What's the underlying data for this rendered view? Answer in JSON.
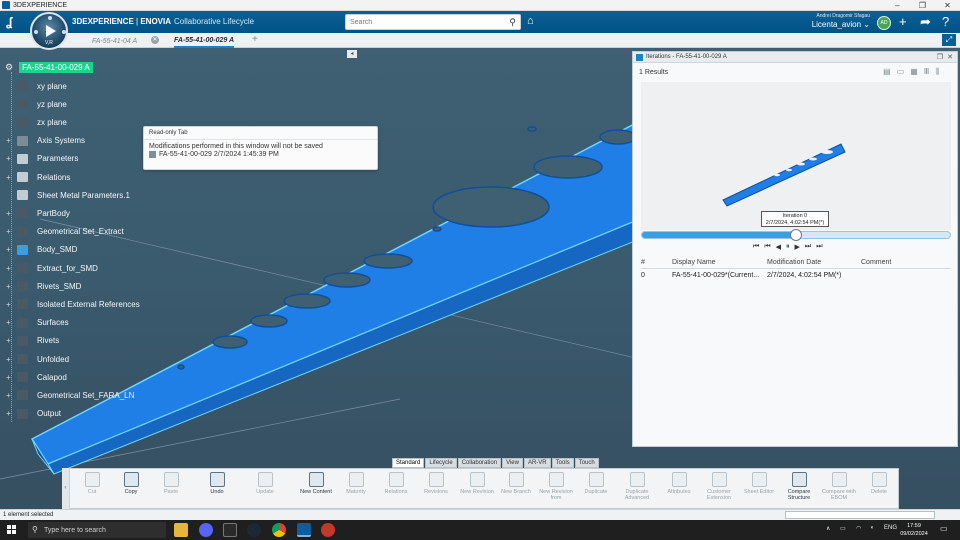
{
  "window": {
    "title": "3DEXPERIENCE",
    "minimize": "–",
    "maximize": "❐",
    "close": "✕"
  },
  "header": {
    "brand_3dx": "3DEXPERIENCE",
    "brand_sep": " | ",
    "brand_app": "ENOVIA",
    "brand_sub": "Collaborative Lifecycle",
    "compass_label": "V,R",
    "search_placeholder": "Search",
    "user_name": "Andrei Dragomir Sfagau",
    "context": "Licenta_avion",
    "avatar": "AD",
    "accent": "#005386"
  },
  "tabs": [
    {
      "label": "FA-55-41-04 A",
      "active": false
    },
    {
      "label": "FA-55-41-00-029 A",
      "active": true
    }
  ],
  "tab_add": "+",
  "tree": {
    "root": "FA-55-41-00-029 A",
    "items": [
      {
        "label": "xy plane",
        "expander": "",
        "color": "#4a5964"
      },
      {
        "label": "yz plane",
        "expander": "",
        "color": "#4a5964"
      },
      {
        "label": "zx plane",
        "expander": "",
        "color": "#4a5964"
      },
      {
        "label": "Axis Systems",
        "expander": "+",
        "color": "#7c8c97"
      },
      {
        "label": "Parameters",
        "expander": "+",
        "color": "#c3ccd2"
      },
      {
        "label": "Relations",
        "expander": "+",
        "color": "#c3ccd2"
      },
      {
        "label": "Sheet Metal Parameters.1",
        "expander": "",
        "color": "#c3ccd2"
      },
      {
        "label": "PartBody",
        "expander": "+",
        "color": "#4a5964"
      },
      {
        "label": "Geometrical Set_Extract",
        "expander": "+",
        "color": "#4a5964"
      },
      {
        "label": "Body_SMD",
        "expander": "+",
        "color": "#3a9ee0"
      },
      {
        "label": "Extract_for_SMD",
        "expander": "+",
        "color": "#4a5964"
      },
      {
        "label": "Rivets_SMD",
        "expander": "+",
        "color": "#4a5964"
      },
      {
        "label": "Isolated External References",
        "expander": "+",
        "color": "#4a5964"
      },
      {
        "label": "Surfaces",
        "expander": "+",
        "color": "#4a5964"
      },
      {
        "label": "Rivets",
        "expander": "+",
        "color": "#4a5964"
      },
      {
        "label": "Unfolded",
        "expander": "+",
        "color": "#4a5964"
      },
      {
        "label": "Calapod",
        "expander": "+",
        "color": "#4a5964"
      },
      {
        "label": "Geometrical Set_FARA_LN",
        "expander": "+",
        "color": "#4a5964"
      },
      {
        "label": "Output",
        "expander": "+",
        "color": "#4a5964"
      }
    ]
  },
  "readonly_tip": {
    "title": "Read-only Tab",
    "message": "Modifications performed in this window will not be saved",
    "reference": "FA-55-41-00-029  2/7/2024 1:45:39 PM"
  },
  "iterations": {
    "title": "Iterations - FA-55-41-00-029 A",
    "results": "1 Results",
    "iteration_label": "Iteration 0",
    "iteration_date": "2/7/2024, 4:02:54 PM(*)",
    "timeline_progress": 0.5,
    "columns": [
      "#",
      "Display Name",
      "Modification Date",
      "Comment"
    ],
    "rows": [
      [
        "0",
        "FA-55-41-00-029*(Current...",
        "2/7/2024, 4:02:54 PM(*)",
        ""
      ]
    ],
    "player": [
      "⏮",
      "⏮",
      "◀",
      "⏸",
      "▶",
      "⏭",
      "⏭"
    ]
  },
  "action_tabs": [
    {
      "label": "Standard",
      "active": true
    },
    {
      "label": "Lifecycle",
      "active": false
    },
    {
      "label": "Collaboration",
      "active": false
    },
    {
      "label": "View",
      "active": false
    },
    {
      "label": "AR-VR",
      "active": false
    },
    {
      "label": "Tools",
      "active": false
    },
    {
      "label": "Touch",
      "active": false
    }
  ],
  "actions": [
    {
      "label": "Cut",
      "enabled": false,
      "icon": "scissors-icon"
    },
    {
      "label": "Copy",
      "enabled": true,
      "icon": "copy-icon"
    },
    {
      "label": "Paste",
      "enabled": false,
      "icon": "paste-icon"
    },
    {
      "label": "Undo",
      "enabled": true,
      "icon": "undo-icon"
    },
    {
      "label": "Update",
      "enabled": false,
      "icon": "update-icon"
    },
    {
      "label": "New Content",
      "enabled": true,
      "icon": "new-content-icon"
    },
    {
      "label": "Maturity",
      "enabled": false,
      "icon": "maturity-icon"
    },
    {
      "label": "Relations",
      "enabled": false,
      "icon": "relations-icon"
    },
    {
      "label": "Revisions",
      "enabled": false,
      "icon": "revisions-icon"
    },
    {
      "label": "New Revision",
      "enabled": false,
      "icon": "new-revision-icon"
    },
    {
      "label": "New Branch",
      "enabled": false,
      "icon": "new-branch-icon"
    },
    {
      "label": "New Revision from",
      "enabled": false,
      "icon": "revision-from-icon"
    },
    {
      "label": "Duplicate",
      "enabled": false,
      "icon": "duplicate-icon"
    },
    {
      "label": "Duplicate Advanced",
      "enabled": false,
      "icon": "duplicate-advanced-icon"
    },
    {
      "label": "Attributes",
      "enabled": false,
      "icon": "attributes-icon"
    },
    {
      "label": "Customer Extension",
      "enabled": false,
      "icon": "customer-extension-icon"
    },
    {
      "label": "Sheet Editor",
      "enabled": false,
      "icon": "sheet-editor-icon"
    },
    {
      "label": "Compare Structure",
      "enabled": true,
      "icon": "compare-structure-icon"
    },
    {
      "label": "Compare with EBOM",
      "enabled": false,
      "icon": "compare-ebom-icon"
    },
    {
      "label": "Delete",
      "enabled": false,
      "icon": "delete-icon"
    }
  ],
  "status": {
    "text": "1 element selected"
  },
  "taskbar": {
    "search_placeholder": "Type here to search",
    "lang": "ENG",
    "time": "17:59",
    "date": "09/02/2024"
  }
}
